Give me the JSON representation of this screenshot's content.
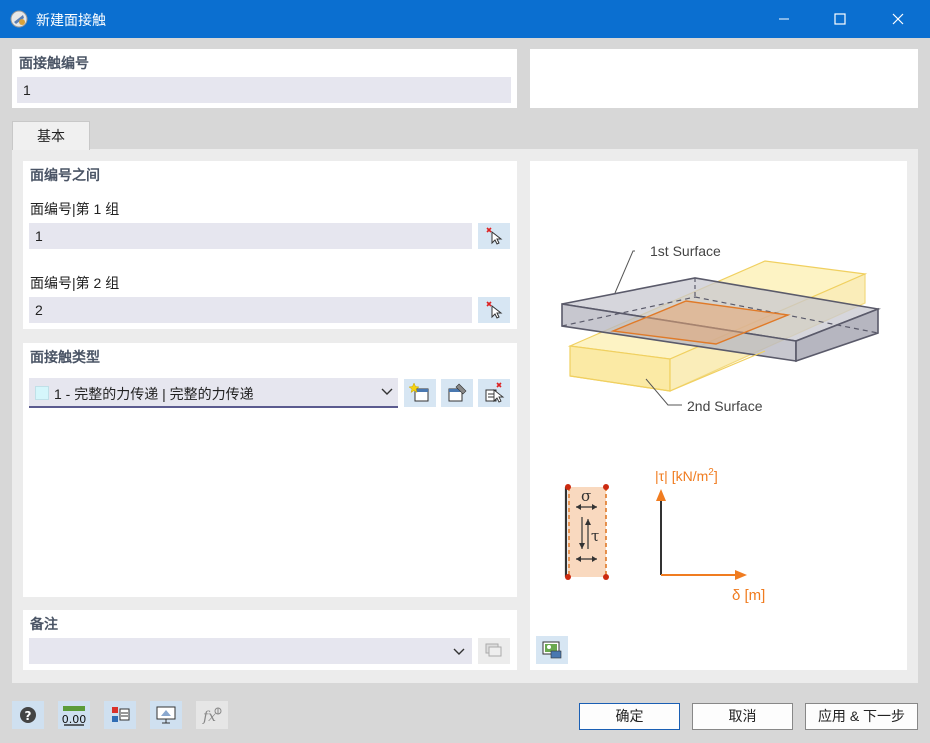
{
  "window": {
    "title": "新建面接触"
  },
  "top": {
    "number_label": "面接触编号",
    "number_value": "1"
  },
  "tabs": [
    {
      "label": "基本"
    }
  ],
  "surfaces": {
    "heading": "面编号之间",
    "group1_label": "面编号|第 1 组",
    "group1_value": "1",
    "group2_label": "面编号|第 2 组",
    "group2_value": "2"
  },
  "contact_type": {
    "heading": "面接触类型",
    "selected": "1 - 完整的力传递 | 完整的力传递",
    "swatch_color": "#d5f6fb"
  },
  "comment": {
    "heading": "备注",
    "value": ""
  },
  "diagram": {
    "surface1_label": "1st Surface",
    "surface2_label": "2nd Surface",
    "sigma_label": "σ",
    "tau_label": "τ",
    "y_axis_label_prefix": "|τ| [kN/m",
    "y_axis_label_exp": "2",
    "y_axis_label_suffix": "]",
    "x_axis_label": "δ [m]",
    "accent_color": "#f07c20",
    "surface2_color": "#f7dc6f"
  },
  "toolbar_icons": [
    "help-icon",
    "number-format-icon",
    "display-properties-icon",
    "view-icon",
    "formula-icon"
  ],
  "buttons": {
    "ok": "确定",
    "cancel": "取消",
    "apply_next": "应用 & 下一步"
  }
}
